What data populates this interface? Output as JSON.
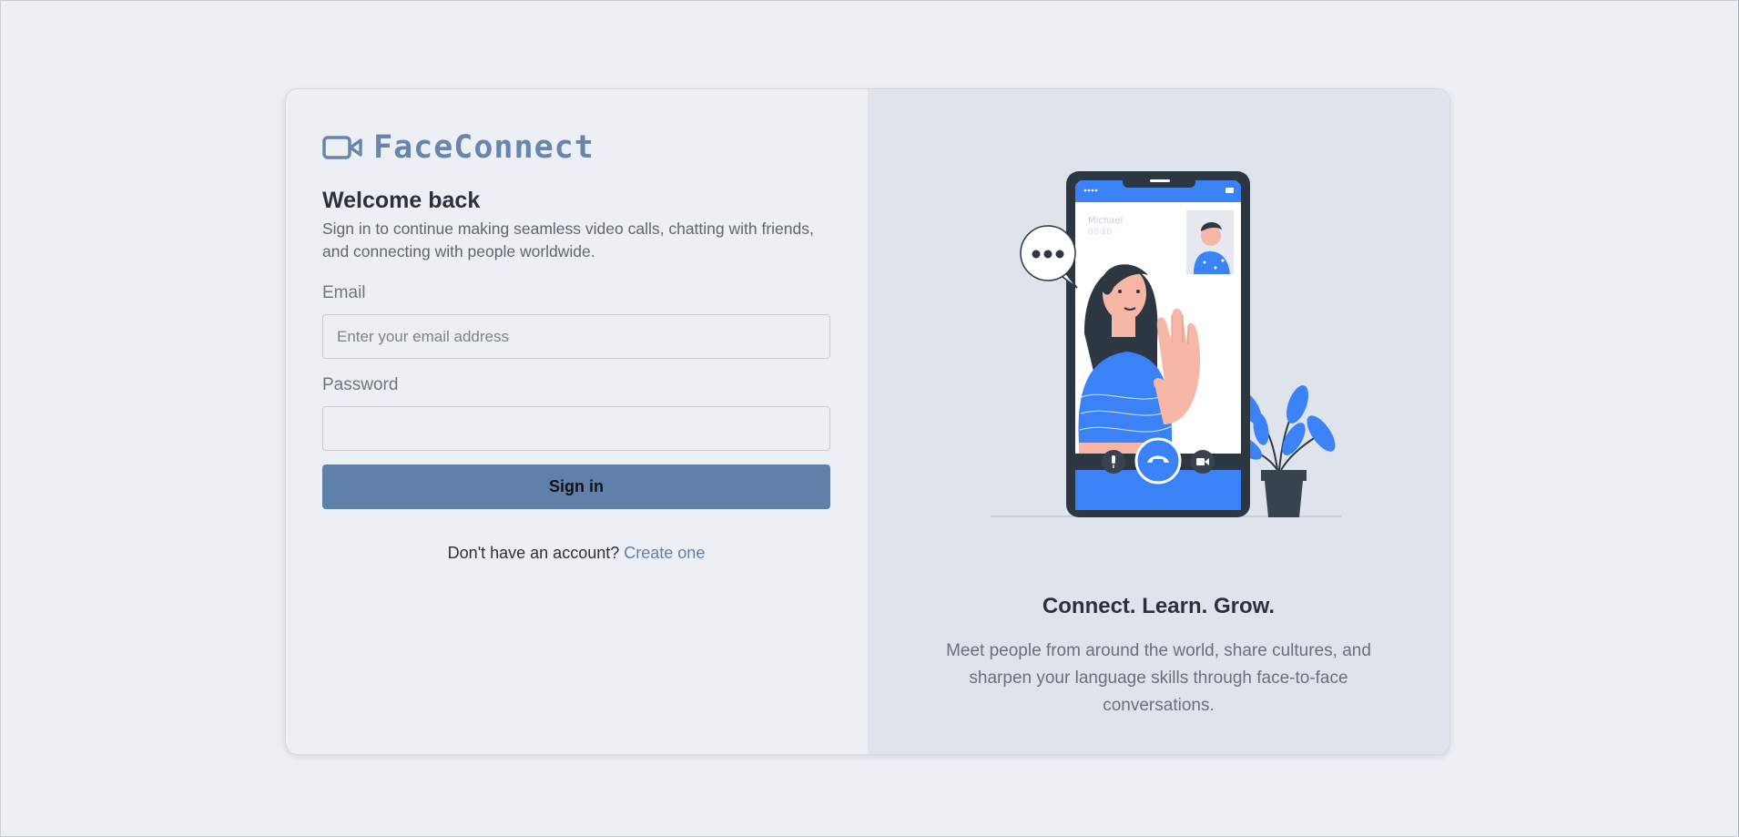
{
  "brand": {
    "name": "FaceConnect",
    "icon": "video-camera-icon"
  },
  "signin": {
    "heading": "Welcome back",
    "subtitle": "Sign in to continue making seamless video calls, chatting with friends, and connecting with people worldwide.",
    "email_label": "Email",
    "email_placeholder": "Enter your email address",
    "email_value": "",
    "password_label": "Password",
    "password_value": "",
    "button_label": "Sign in",
    "no_account_text": "Don't have an account?",
    "create_link": "Create one"
  },
  "promo": {
    "illustration": "video-call-illustration",
    "caller_name": "Michael",
    "call_time": "00:10",
    "tagline": "Connect. Learn. Grow.",
    "description": "Meet people from around the world, share cultures, and sharpen your language skills through face-to-face conversations."
  },
  "colors": {
    "brand": "#6886ac",
    "button": "#5f80a9",
    "link": "#5f80a9",
    "page_bg": "#eceff4",
    "panel_bg": "#dfe4ec",
    "illustration_blue": "#3b82f6"
  }
}
